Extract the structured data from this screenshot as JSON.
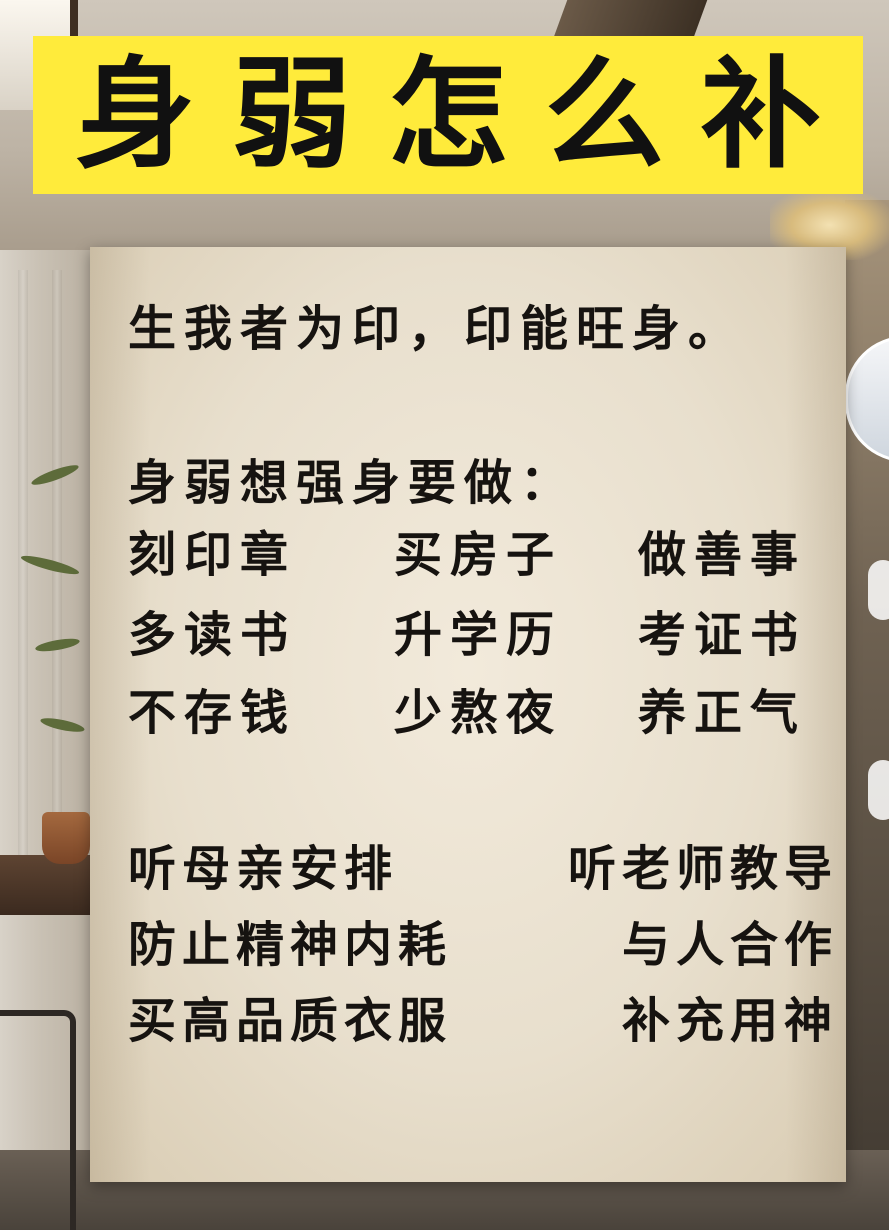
{
  "title": {
    "chars": [
      "身",
      "弱",
      "怎",
      "么",
      "补"
    ]
  },
  "paper": {
    "line1": "生我者为印，印能旺身。",
    "line2": "身弱想强身要做：",
    "grid": [
      [
        "刻印章",
        "买房子",
        "做善事"
      ],
      [
        "多读书",
        "升学历",
        "考证书"
      ],
      [
        "不存钱",
        "少熬夜",
        "养正气"
      ]
    ],
    "pairs": [
      [
        "听母亲安排",
        "听老师教导"
      ],
      [
        "防止精神内耗",
        "与人合作"
      ],
      [
        "买高品质衣服",
        "补充用神"
      ]
    ]
  },
  "colors": {
    "banner": "#ffeb3b",
    "paper": "#ece3d2",
    "text": "#161310"
  }
}
